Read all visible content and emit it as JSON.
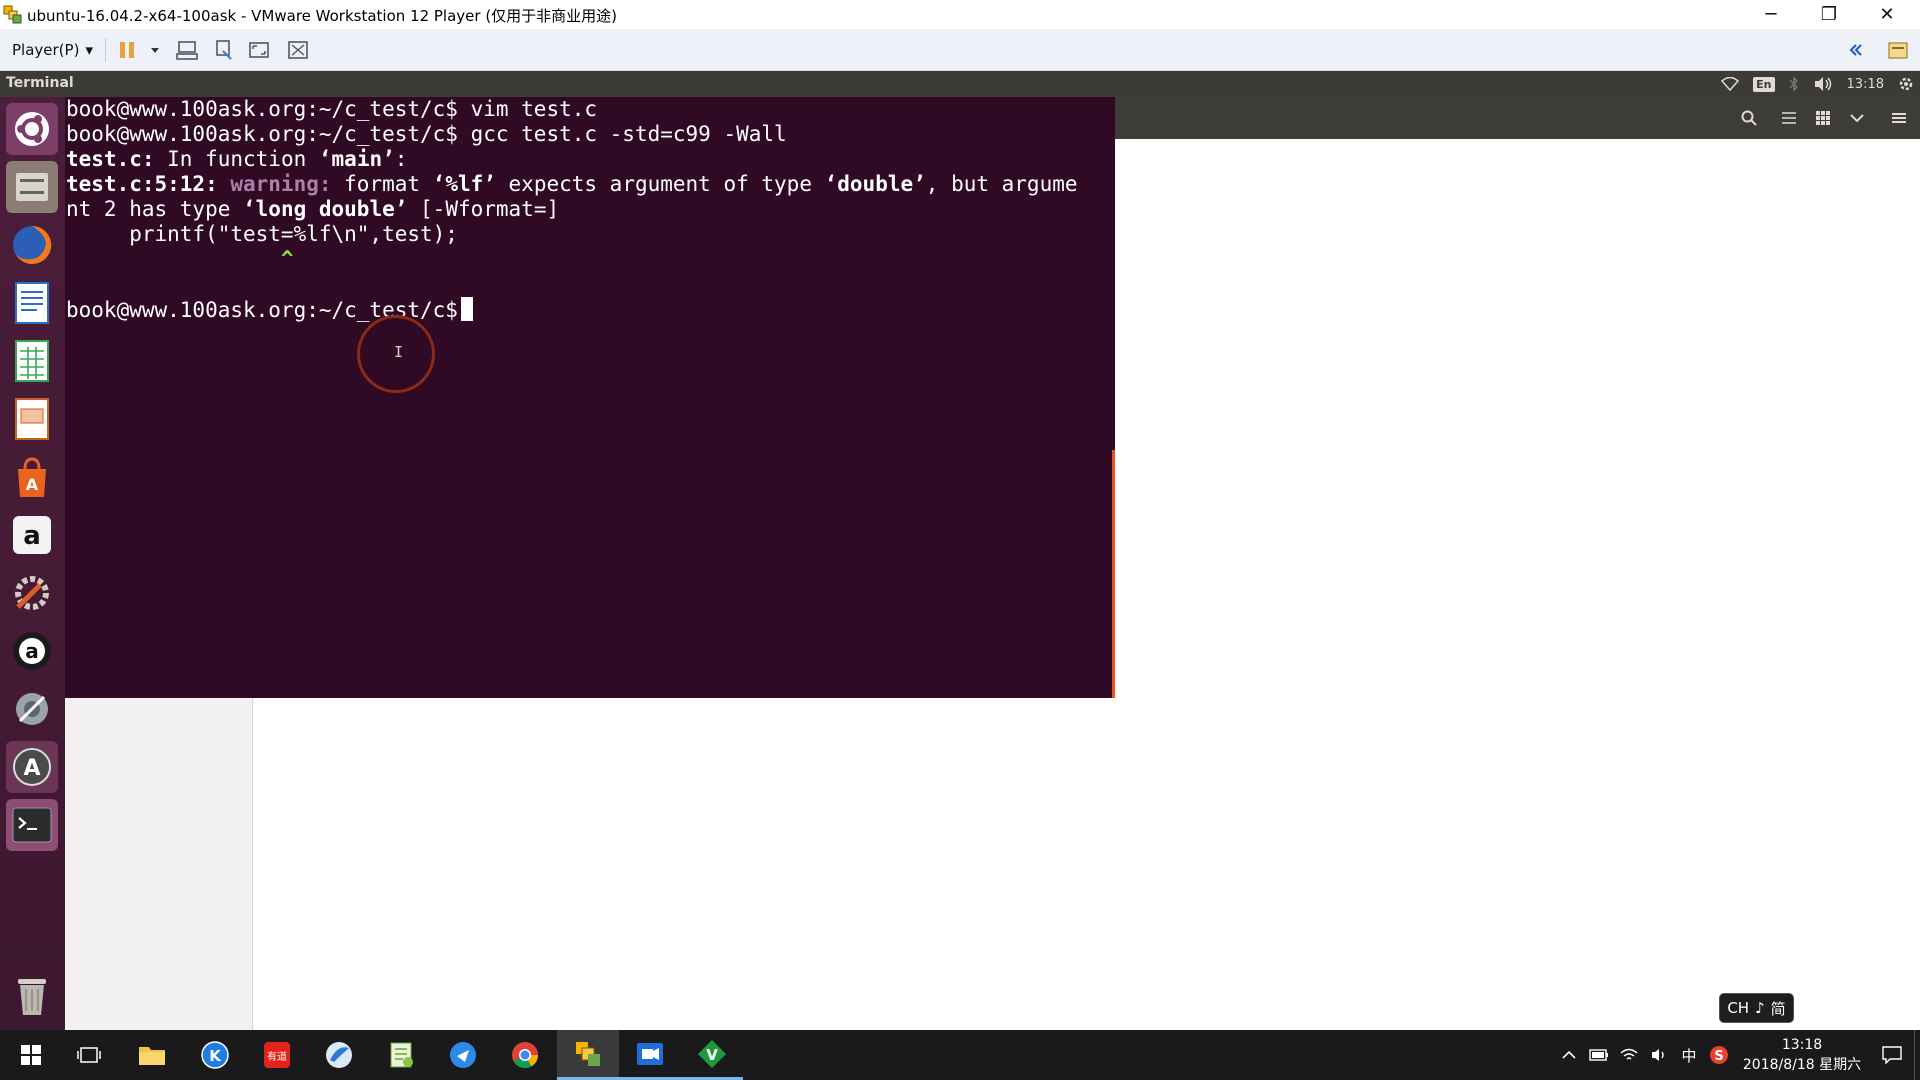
{
  "window": {
    "title": "ubuntu-16.04.2-x64-100ask - VMware Workstation 12 Player (仅用于非商业用途)",
    "minimize": "─",
    "restore": "❐",
    "close": "✕"
  },
  "vmware_toolbar": {
    "player_menu": "Player(P)",
    "dropdown": "▾"
  },
  "ubuntu_panel": {
    "app_title": "Terminal",
    "input_method": "En",
    "time": "13:18"
  },
  "terminal": {
    "lines": [
      {
        "prompt": "book@www.100ask.org:~/c_test/c$",
        "command": " vim test.c"
      },
      {
        "prompt": "book@www.100ask.org:~/c_test/c$",
        "command": " gcc test.c -std=c99 -Wall"
      }
    ],
    "diag_file": "test.c:",
    "diag_func_text": " In function ",
    "diag_func_name": "‘main’",
    "diag_func_end": ":",
    "warn_loc": "test.c:5:12:",
    "warn_label": " warning:",
    "warn_msg1": " format ",
    "warn_fmt": "‘%lf’",
    "warn_msg2": " expects argument of type ",
    "warn_type1": "‘double’",
    "warn_msg3": ", but argume",
    "warn_msg4": "nt 2 has type ",
    "warn_type2": "‘long double’",
    "warn_flag": " [-Wformat=]",
    "source_line": "     printf(\"test=%lf\\n\",test);",
    "caret_line": "                 ^",
    "final_prompt": "book@www.100ask.org:~/c_test/c$"
  },
  "cursor_glyph": "I",
  "ime": {
    "lang": "CH",
    "mode": "♪",
    "variant": "简"
  },
  "taskbar": {
    "tray_input": "中",
    "time": "13:18",
    "date": "2018/8/18 星期六"
  },
  "colors": {
    "terminal_bg": "#300a24",
    "warning": "#ad7fa8",
    "caret": "#8ae234",
    "launcher_bg": "#4b1e3a",
    "taskbar_bg": "#1a1a1c"
  }
}
